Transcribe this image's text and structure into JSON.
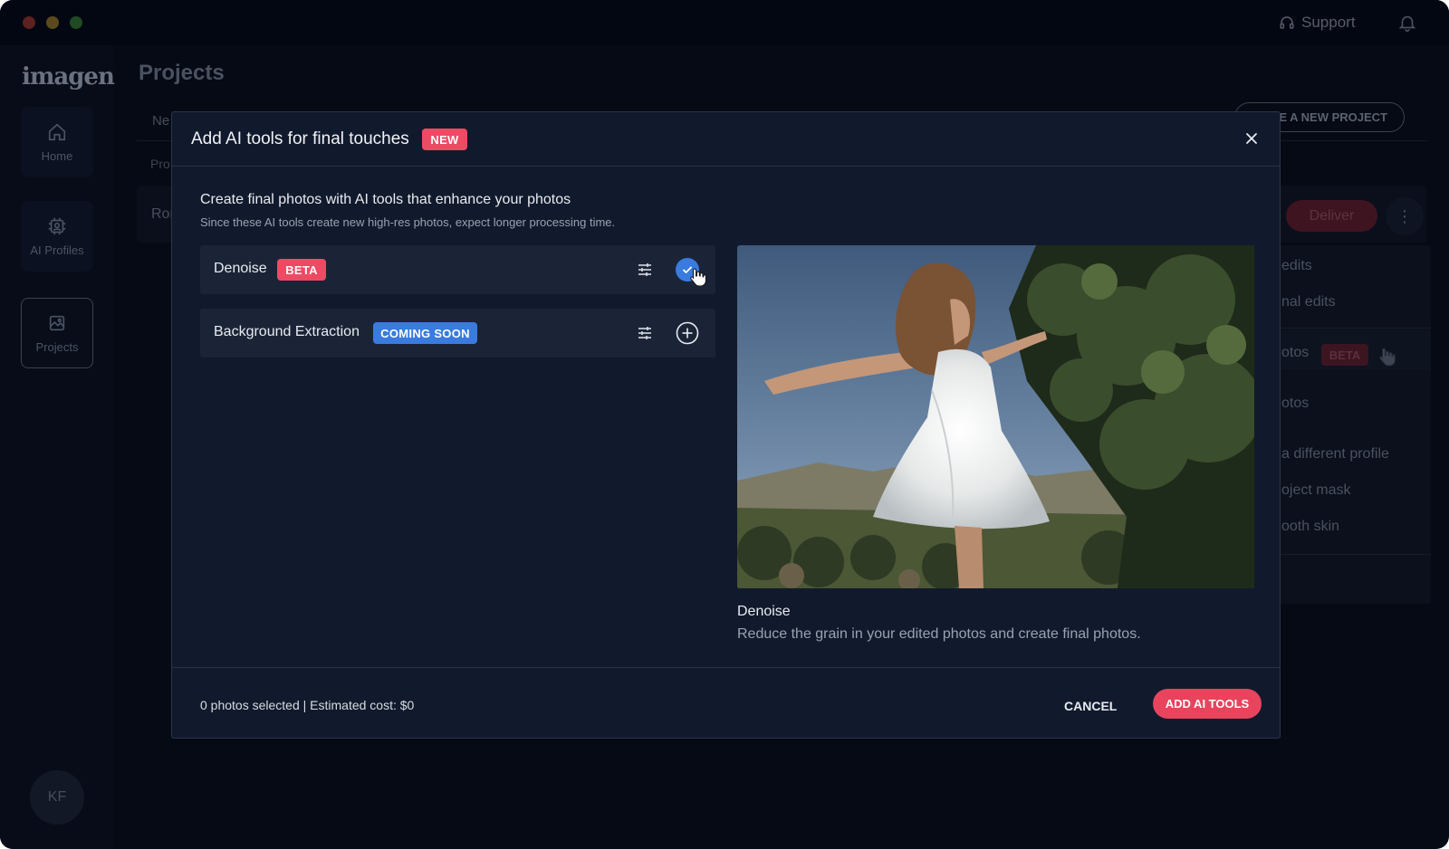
{
  "app": {
    "logo": "imagen",
    "support_label": "Support",
    "user_initials": "KF"
  },
  "sidebar": {
    "items": [
      {
        "label": "Home",
        "icon": "home-icon"
      },
      {
        "label": "AI Profiles",
        "icon": "ai-profile-icon"
      },
      {
        "label": "Projects",
        "icon": "projects-icon",
        "active": true
      }
    ]
  },
  "background": {
    "page_title": "Projects",
    "tab_partial": "Ne",
    "subheader_partial": "Pro",
    "row_partial": "Ron",
    "create_button": "CREATE A NEW PROJECT",
    "deliver_button": "Deliver",
    "menu": {
      "items": [
        "edits",
        "nal edits",
        "otos",
        "otos",
        "a different profile",
        "oject mask",
        "ooth skin"
      ],
      "beta_badge": "BETA"
    }
  },
  "modal": {
    "title": "Add AI tools for final touches",
    "title_badge": "NEW",
    "intro_title": "Create final photos with AI tools that enhance your photos",
    "intro_subtitle": "Since these AI tools create new high-res photos, expect longer processing time.",
    "tools": [
      {
        "name": "Denoise",
        "badge": "BETA",
        "badge_color": "#ef4a63",
        "selected": true
      },
      {
        "name": "Background Extraction",
        "badge": "COMING SOON",
        "badge_color": "#3a7be0",
        "selected": false
      }
    ],
    "preview": {
      "title": "Denoise",
      "description": "Reduce the grain in your edited photos and create final photos."
    },
    "footer": {
      "selection_info": "0 photos selected | Estimated cost: $0",
      "cancel_label": "CANCEL",
      "confirm_label": "ADD AI TOOLS"
    }
  },
  "colors": {
    "accent_red": "#e8445e",
    "accent_blue": "#3a7be0",
    "modal_bg": "#111a2c",
    "row_bg": "#1b2437"
  }
}
